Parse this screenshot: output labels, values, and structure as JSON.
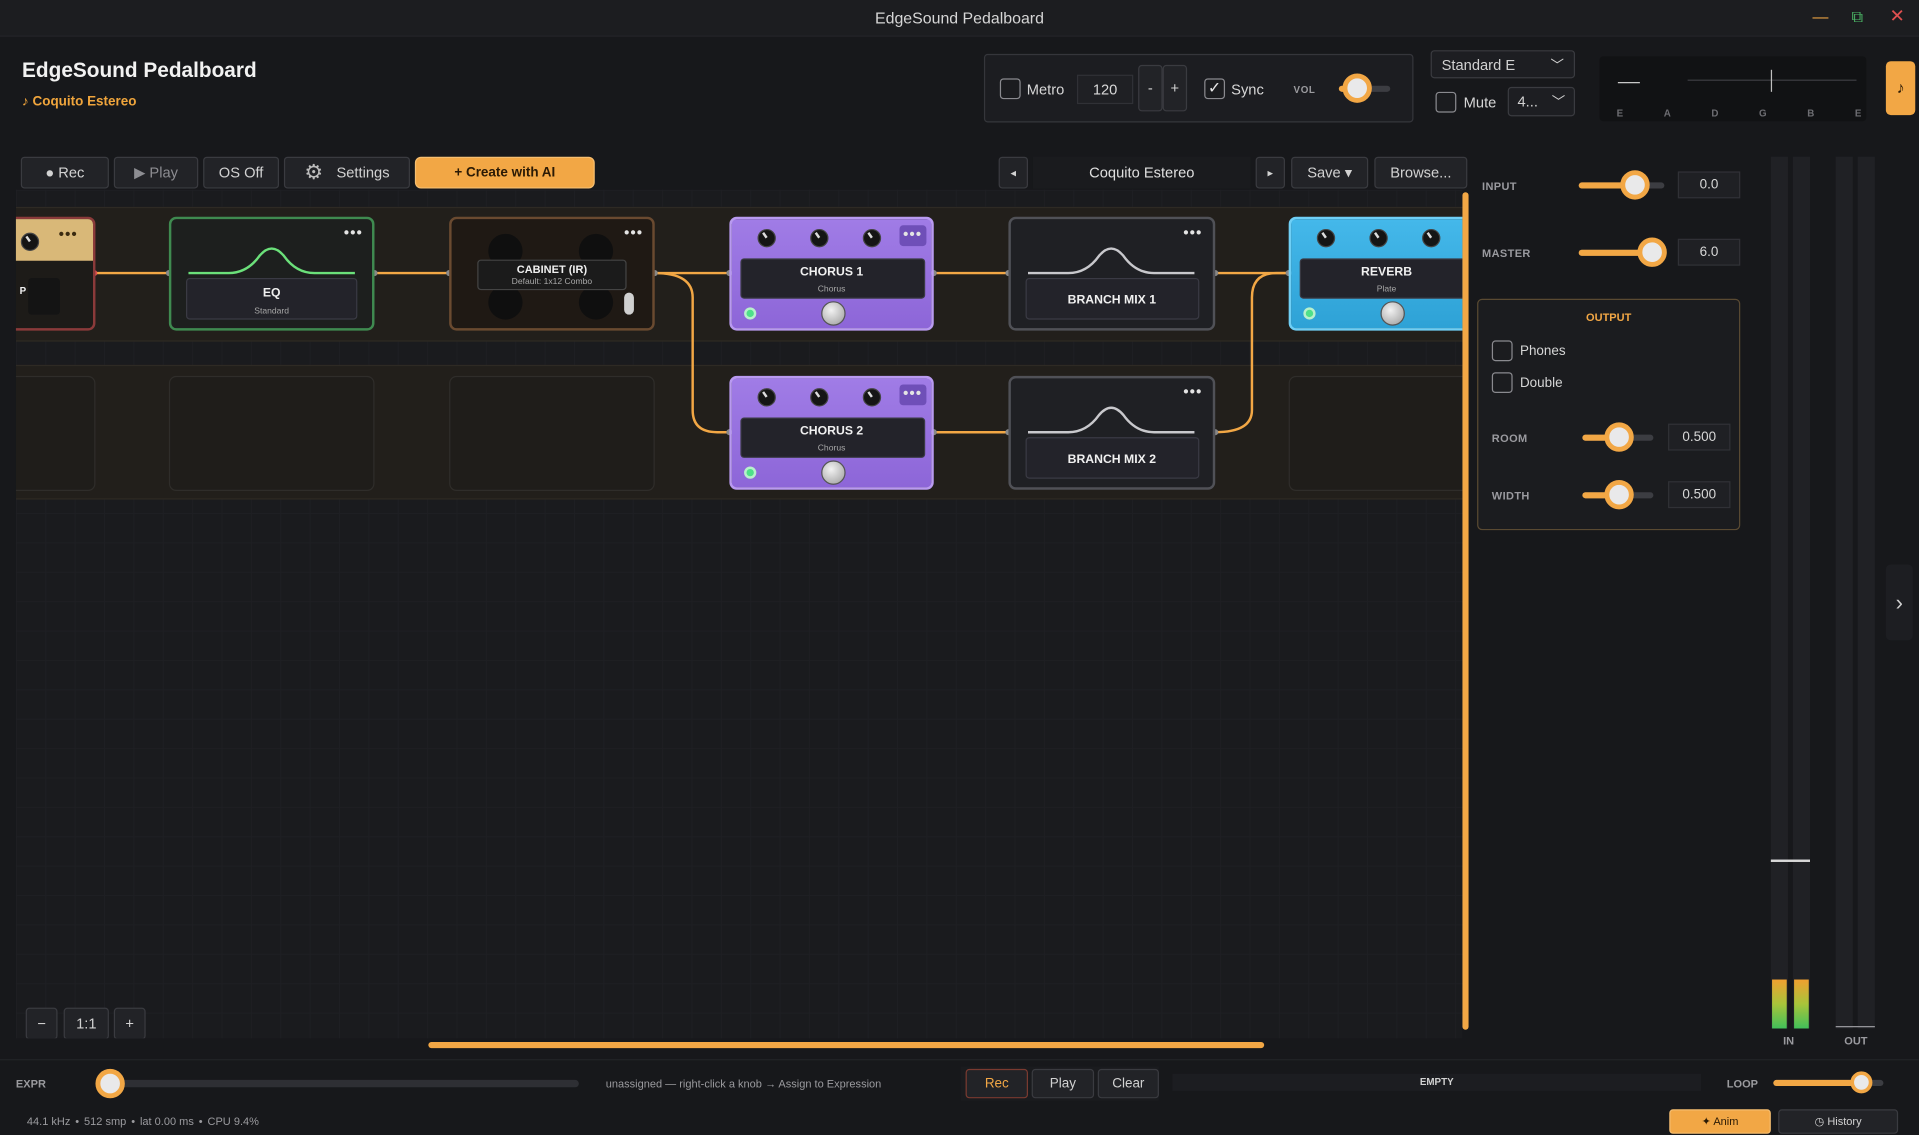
{
  "window": {
    "title": "EdgeSound Pedalboard"
  },
  "header": {
    "app_title": "EdgeSound Pedalboard",
    "preset_name": "♪ Coquito Estereo"
  },
  "transport": {
    "metro_label": "Metro",
    "bpm": "120",
    "minus": "-",
    "plus": "+",
    "sync_label": "Sync",
    "vol_label": "VOL",
    "vol_level": 0.35
  },
  "tuning": {
    "selected": "Standard E",
    "mute_label": "Mute",
    "mute_option": "4..."
  },
  "tuner": {
    "strings": [
      "E",
      "A",
      "D",
      "G",
      "B",
      "E"
    ],
    "note_glyph": "♪"
  },
  "toolbar": {
    "rec": "● Rec",
    "play": "▶ Play",
    "os": "OS Off",
    "settings": "Settings",
    "create_ai": "+ Create with AI",
    "preset": "Coquito Estereo",
    "prev": "◂",
    "next": "▸",
    "save": "Save ▾",
    "browse": "Browse..."
  },
  "pedals": {
    "amp": {
      "name": "P"
    },
    "eq": {
      "name": "EQ",
      "sub": "Standard"
    },
    "cabinet": {
      "name": "CABINET (IR)",
      "sub": "Default: 1x12 Combo"
    },
    "chorus1": {
      "name": "CHORUS 1",
      "sub": "Chorus"
    },
    "chorus2": {
      "name": "CHORUS 2",
      "sub": "Chorus"
    },
    "branch1": {
      "name": "BRANCH MIX 1"
    },
    "branch2": {
      "name": "BRANCH MIX 2"
    },
    "reverb": {
      "name": "REVERB",
      "sub": "Plate"
    },
    "menu_dots": "•••"
  },
  "zoom": {
    "minus": "−",
    "level": "1:1",
    "plus": "+"
  },
  "right_panel": {
    "input_label": "INPUT",
    "input_value": "0.0",
    "input_level": 0.65,
    "master_label": "MASTER",
    "master_value": "6.0",
    "master_level": 0.85,
    "output_title": "OUTPUT",
    "phones_label": "Phones",
    "double_label": "Double",
    "room_label": "ROOM",
    "room_value": "0.500",
    "width_label": "WIDTH",
    "width_value": "0.500"
  },
  "meters": {
    "in_label": "IN",
    "out_label": "OUT"
  },
  "bottom": {
    "expr_label": "EXPR",
    "expr_hint": "unassigned — right-click a knob → Assign to Expression",
    "rec": "Rec",
    "play": "Play",
    "clear": "Clear",
    "looper_state": "EMPTY",
    "loop_label": "LOOP",
    "loop_level": 0.8,
    "status": [
      "44.1 kHz",
      "512 smp",
      "lat 0.00 ms",
      "CPU 9.4%"
    ],
    "anim": "✦ Anim",
    "history": "◷ History"
  },
  "colors": {
    "accent": "#f2a745",
    "chorus": "#9b6fe0",
    "reverb": "#3aaee0"
  }
}
